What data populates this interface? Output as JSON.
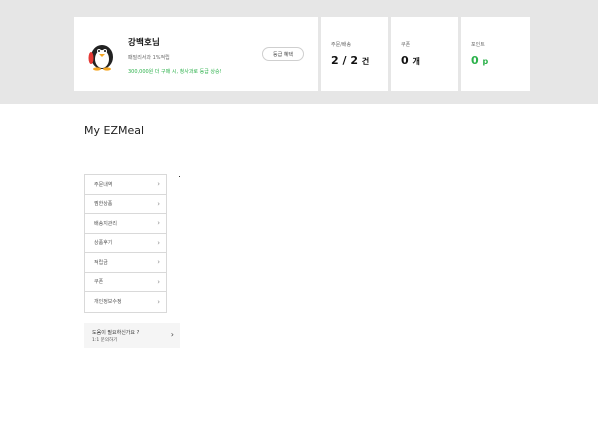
{
  "profile": {
    "name": "강백호님",
    "grade": "패밀리서과 1%적립",
    "message": "300,000원 더 구매 시, 청사과로 등급 상승!",
    "grade_button": "등급 혜택"
  },
  "stats": {
    "orders": {
      "label": "주문/배송",
      "value": "2 / 2",
      "unit": "건"
    },
    "coupon": {
      "label": "쿠폰",
      "value": "0",
      "unit": "개"
    },
    "points": {
      "label": "포인트",
      "value": "0",
      "unit": "p",
      "color": "#2bb14a"
    }
  },
  "page_title": "My EZMeal",
  "menu": {
    "items": [
      {
        "label": "주문내역"
      },
      {
        "label": "찜한상품"
      },
      {
        "label": "배송지관리"
      },
      {
        "label": "상품후기"
      },
      {
        "label": "적립금"
      },
      {
        "label": "쿠폰"
      },
      {
        "label": "개인정보수정"
      }
    ]
  },
  "help": {
    "title": "도움이 필요하신가요 ?",
    "subtitle": "1:1 문의하기"
  },
  "icons": {
    "avatar": "penguin-avatar-icon",
    "menu_chevron": "chevron-right-icon"
  },
  "colors": {
    "accent_green": "#2bb14a",
    "band_gray": "#e6e6e6"
  }
}
